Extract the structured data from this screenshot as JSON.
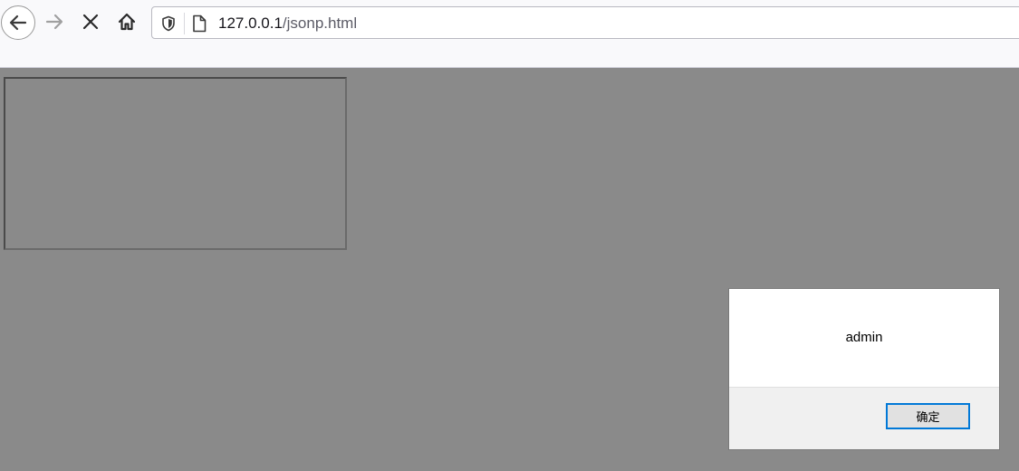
{
  "toolbar": {
    "buttons": {
      "back": "back-arrow-icon",
      "forward": "forward-arrow-icon",
      "stop": "close-icon",
      "home": "home-icon"
    },
    "urlbar": {
      "host": "127.0.0.1",
      "path": "/jsonp.html",
      "icons": [
        "shield-icon",
        "page-icon"
      ]
    }
  },
  "page": {
    "overlay_color": "#8a8a8a"
  },
  "dialog": {
    "message": "admin",
    "ok_label": "确定",
    "accent": "#0078d7"
  }
}
